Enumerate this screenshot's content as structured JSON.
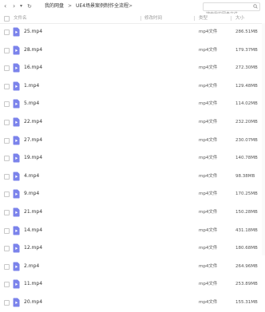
{
  "toolbar": {
    "back_glyph": "‹",
    "forward_glyph": "›",
    "dropdown_glyph": "▾",
    "refresh_glyph": "↻",
    "breadcrumb": [
      "我的网盘",
      "UE4场景案例制作全流程"
    ],
    "separator": ">",
    "search_placeholder": "搜索我的网盘文件"
  },
  "header": {
    "name": "文件名",
    "modified": "修改时间",
    "type": "类型",
    "size": "大小"
  },
  "files": [
    {
      "name": "25.mp4",
      "type": "mp4文件",
      "size": "286.51MB"
    },
    {
      "name": "28.mp4",
      "type": "mp4文件",
      "size": "179.37MB"
    },
    {
      "name": "16.mp4",
      "type": "mp4文件",
      "size": "272.30MB"
    },
    {
      "name": "1.mp4",
      "type": "mp4文件",
      "size": "129.48MB"
    },
    {
      "name": "5.mp4",
      "type": "mp4文件",
      "size": "114.02MB"
    },
    {
      "name": "22.mp4",
      "type": "mp4文件",
      "size": "232.20MB"
    },
    {
      "name": "27.mp4",
      "type": "mp4文件",
      "size": "230.07MB"
    },
    {
      "name": "19.mp4",
      "type": "mp4文件",
      "size": "140.78MB"
    },
    {
      "name": "4.mp4",
      "type": "mp4文件",
      "size": "98.38MB"
    },
    {
      "name": "9.mp4",
      "type": "mp4文件",
      "size": "170.25MB"
    },
    {
      "name": "21.mp4",
      "type": "mp4文件",
      "size": "150.28MB"
    },
    {
      "name": "14.mp4",
      "type": "mp4文件",
      "size": "431.18MB"
    },
    {
      "name": "12.mp4",
      "type": "mp4文件",
      "size": "180.68MB"
    },
    {
      "name": "2.mp4",
      "type": "mp4文件",
      "size": "264.96MB"
    },
    {
      "name": "11.mp4",
      "type": "mp4文件",
      "size": "253.89MB"
    },
    {
      "name": "20.mp4",
      "type": "mp4文件",
      "size": "155.31MB"
    }
  ],
  "colors": {
    "file_icon": "#7b83eb",
    "accent": "#06a7ff"
  },
  "icons": {
    "file": "video-file-icon",
    "search": "search-icon"
  }
}
